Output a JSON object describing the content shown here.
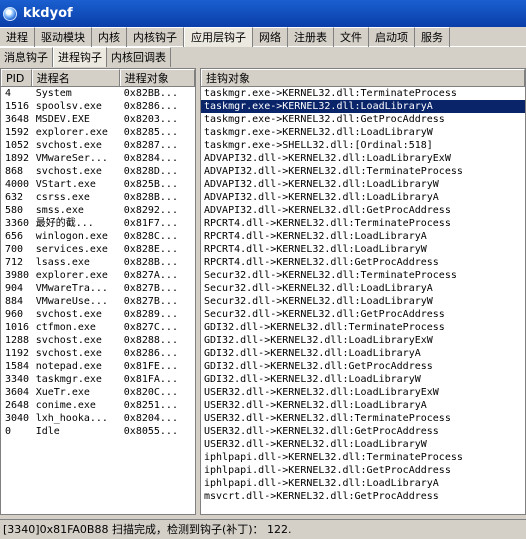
{
  "window": {
    "title": "kkdyof"
  },
  "main_tabs": [
    "进程",
    "驱动模块",
    "内核",
    "内核钩子",
    "应用层钩子",
    "网络",
    "注册表",
    "文件",
    "启动项",
    "服务"
  ],
  "sub_tabs": [
    "消息钩子",
    "进程钩子",
    "内核回调表"
  ],
  "process_table": {
    "headers": [
      "PID",
      "进程名",
      "进程对象"
    ],
    "rows": [
      [
        "4",
        "System",
        "0x82BB..."
      ],
      [
        "1516",
        "spoolsv.exe",
        "0x8286..."
      ],
      [
        "3648",
        "MSDEV.EXE",
        "0x8203..."
      ],
      [
        "1592",
        "explorer.exe",
        "0x8285..."
      ],
      [
        "1052",
        "svchost.exe",
        "0x8287..."
      ],
      [
        "1892",
        "VMwareSer...",
        "0x8284..."
      ],
      [
        "868",
        "svchost.exe",
        "0x828D..."
      ],
      [
        "4000",
        "VStart.exe",
        "0x825B..."
      ],
      [
        "632",
        "csrss.exe",
        "0x828B..."
      ],
      [
        "580",
        "smss.exe",
        "0x8292..."
      ],
      [
        "3360",
        "最好的截...",
        "0x81F7..."
      ],
      [
        "656",
        "winlogon.exe",
        "0x828C..."
      ],
      [
        "700",
        "services.exe",
        "0x828E..."
      ],
      [
        "712",
        "lsass.exe",
        "0x828B..."
      ],
      [
        "3980",
        "explorer.exe",
        "0x827A..."
      ],
      [
        "904",
        "VMwareTra...",
        "0x827B..."
      ],
      [
        "884",
        "VMwareUse...",
        "0x827B..."
      ],
      [
        "960",
        "svchost.exe",
        "0x8289..."
      ],
      [
        "1016",
        "ctfmon.exe",
        "0x827C..."
      ],
      [
        "1288",
        "svchost.exe",
        "0x8288..."
      ],
      [
        "1192",
        "svchost.exe",
        "0x8286..."
      ],
      [
        "1584",
        "notepad.exe",
        "0x81FE..."
      ],
      [
        "3340",
        "taskmgr.exe",
        "0x81FA..."
      ],
      [
        "3604",
        "XueTr.exe",
        "0x820C..."
      ],
      [
        "2648",
        "conime.exe",
        "0x8251..."
      ],
      [
        "3040",
        "lxh_hooka...",
        "0x8204..."
      ],
      [
        "0",
        "Idle",
        "0x8055..."
      ]
    ]
  },
  "hook_table": {
    "header": "挂钩对象",
    "selected_index": 1,
    "rows": [
      "taskmgr.exe->KERNEL32.dll:TerminateProcess",
      "taskmgr.exe->KERNEL32.dll:LoadLibraryA",
      "taskmgr.exe->KERNEL32.dll:GetProcAddress",
      "taskmgr.exe->KERNEL32.dll:LoadLibraryW",
      "taskmgr.exe->SHELL32.dll:[Ordinal:518]",
      "ADVAPI32.dll->KERNEL32.dll:LoadLibraryExW",
      "ADVAPI32.dll->KERNEL32.dll:TerminateProcess",
      "ADVAPI32.dll->KERNEL32.dll:LoadLibraryW",
      "ADVAPI32.dll->KERNEL32.dll:LoadLibraryA",
      "ADVAPI32.dll->KERNEL32.dll:GetProcAddress",
      "RPCRT4.dll->KERNEL32.dll:TerminateProcess",
      "RPCRT4.dll->KERNEL32.dll:LoadLibraryA",
      "RPCRT4.dll->KERNEL32.dll:LoadLibraryW",
      "RPCRT4.dll->KERNEL32.dll:GetProcAddress",
      "Secur32.dll->KERNEL32.dll:TerminateProcess",
      "Secur32.dll->KERNEL32.dll:LoadLibraryA",
      "Secur32.dll->KERNEL32.dll:LoadLibraryW",
      "Secur32.dll->KERNEL32.dll:GetProcAddress",
      "GDI32.dll->KERNEL32.dll:TerminateProcess",
      "GDI32.dll->KERNEL32.dll:LoadLibraryExW",
      "GDI32.dll->KERNEL32.dll:LoadLibraryA",
      "GDI32.dll->KERNEL32.dll:GetProcAddress",
      "GDI32.dll->KERNEL32.dll:LoadLibraryW",
      "USER32.dll->KERNEL32.dll:LoadLibraryExW",
      "USER32.dll->KERNEL32.dll:LoadLibraryA",
      "USER32.dll->KERNEL32.dll:TerminateProcess",
      "USER32.dll->KERNEL32.dll:GetProcAddress",
      "USER32.dll->KERNEL32.dll:LoadLibraryW",
      "iphlpapi.dll->KERNEL32.dll:TerminateProcess",
      "iphlpapi.dll->KERNEL32.dll:GetProcAddress",
      "iphlpapi.dll->KERNEL32.dll:LoadLibraryA",
      "msvcrt.dll->KERNEL32.dll:GetProcAddress"
    ]
  },
  "status_bar": {
    "text": "[3340]0x81FA0B88 扫描完成，检测到钩子(补丁)： 122."
  }
}
